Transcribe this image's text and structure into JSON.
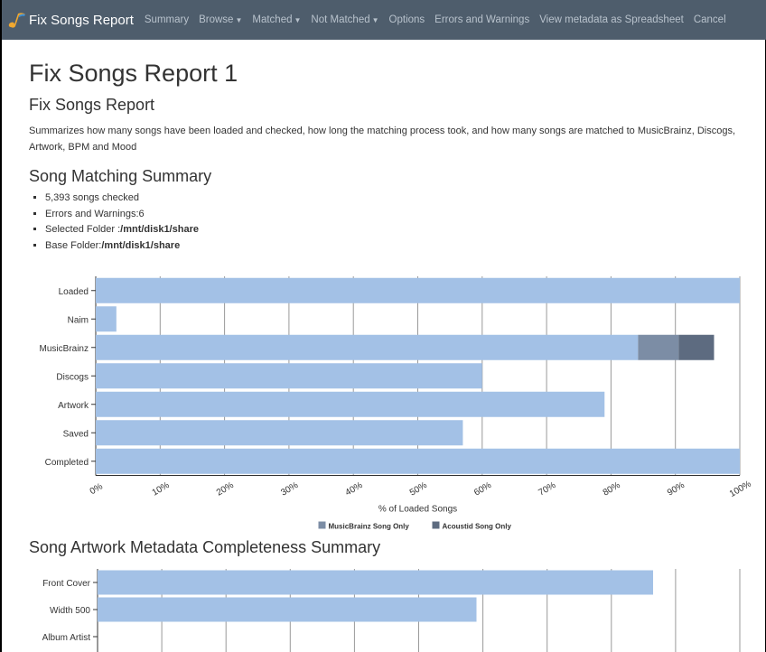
{
  "nav": {
    "brand": "Fix Songs Report",
    "items": [
      {
        "label": "Summary",
        "caret": false
      },
      {
        "label": "Browse",
        "caret": true
      },
      {
        "label": "Matched",
        "caret": true
      },
      {
        "label": "Not Matched",
        "caret": true
      },
      {
        "label": "Options",
        "caret": false
      },
      {
        "label": "Errors and Warnings",
        "caret": false
      },
      {
        "label": "View metadata as Spreadsheet",
        "caret": false
      },
      {
        "label": "Cancel",
        "caret": false
      }
    ]
  },
  "page": {
    "title": "Fix Songs Report 1",
    "subtitle": "Fix Songs Report",
    "description": "Summarizes how many songs have been loaded and checked, how long the matching process took, and how many songs are matched to MusicBrainz, Discogs, Artwork, BPM and Mood",
    "summary_heading": "Song Matching Summary",
    "summary_items": [
      {
        "label": "5,393 songs checked",
        "value": ""
      },
      {
        "label": "Errors and Warnings:6",
        "value": ""
      },
      {
        "label": "Selected Folder :",
        "value": "/mnt/disk1/share"
      },
      {
        "label": "Base Folder:",
        "value": "/mnt/disk1/share"
      }
    ],
    "artwork_heading": "Song Artwork Metadata Completeness Summary"
  },
  "colors": {
    "main": "#a3c1e6",
    "musicbrainz_only": "#7c8da5",
    "acoustid_only": "#5d6b80",
    "navbar": "#4e5d6c"
  },
  "chart_data": [
    {
      "type": "bar",
      "orientation": "horizontal",
      "stacked": true,
      "categories": [
        "Loaded",
        "Naim",
        "MusicBrainz",
        "Discogs",
        "Artwork",
        "Saved",
        "Completed"
      ],
      "series": [
        {
          "name": "",
          "values": [
            100,
            3.2,
            84.2,
            60,
            79,
            57,
            100
          ]
        },
        {
          "name": "MusicBrainz Song Only",
          "values": [
            0,
            0,
            6.3,
            0,
            0,
            0,
            0
          ]
        },
        {
          "name": "Acoustid Song Only",
          "values": [
            0,
            0,
            5.5,
            0,
            0,
            0,
            0
          ]
        }
      ],
      "xticks": [
        "0%",
        "10%",
        "20%",
        "30%",
        "40%",
        "50%",
        "60%",
        "70%",
        "80%",
        "90%",
        "100%"
      ],
      "xlabel": "% of Loaded Songs",
      "xlim": [
        0,
        100
      ],
      "grid": true,
      "legend": "bottom-center"
    },
    {
      "type": "bar",
      "orientation": "horizontal",
      "categories": [
        "Front Cover",
        "Width 500",
        "Album Artist"
      ],
      "series": [
        {
          "name": "",
          "values": [
            86.5,
            59,
            0
          ]
        }
      ],
      "xlim": [
        0,
        100
      ],
      "grid": true
    }
  ]
}
